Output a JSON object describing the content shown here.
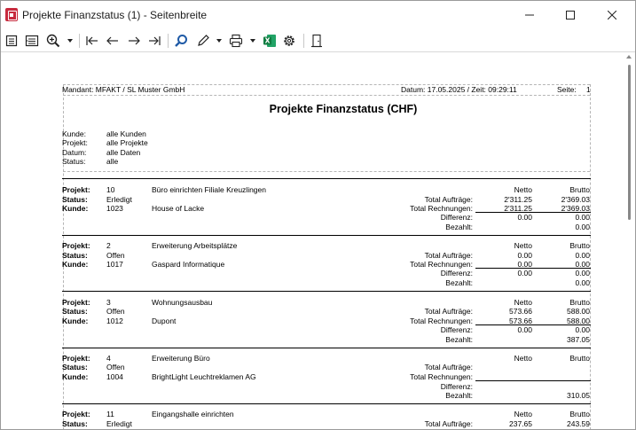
{
  "window": {
    "title": "Projekte Finanzstatus (1) - Seitenbreite",
    "controls": {
      "minimize": "minimize-icon",
      "maximize": "maximize-icon",
      "close": "close-icon"
    }
  },
  "toolbar": {
    "icons": [
      "single-page-icon",
      "page-width-icon",
      "zoom-icon",
      "first-page-icon",
      "previous-page-icon",
      "next-page-icon",
      "last-page-icon",
      "search-icon",
      "edit-icon",
      "print-icon",
      "excel-export-icon",
      "settings-icon",
      "exit-icon"
    ]
  },
  "report": {
    "mandant": "Mandant: MFAKT / SL Muster GmbH",
    "datum": "Datum: 17.05.2025 / Zeit: 09:29:11",
    "seite": "Seite:",
    "seite_nr": "1",
    "title": "Projekte Finanzstatus (CHF)",
    "filters": [
      {
        "label": "Kunde:",
        "value": "alle Kunden"
      },
      {
        "label": "Projekt:",
        "value": "alle Projekte"
      },
      {
        "label": "Datum:",
        "value": "alle Daten"
      },
      {
        "label": "Status:",
        "value": "alle"
      }
    ],
    "labels": {
      "projekt": "Projekt:",
      "status": "Status:",
      "kunde": "Kunde:",
      "netto": "Netto",
      "brutto": "Brutto",
      "total_auftraege": "Total Aufträge:",
      "total_rechnungen": "Total Rechnungen:",
      "differenz": "Differenz:",
      "bezahlt": "Bezahlt:"
    },
    "projects": [
      {
        "nr": "10",
        "name": "Büro einrichten Filiale Kreuzlingen",
        "status": "Erledigt",
        "kunde_nr": "1023",
        "kunde": "House of Lacke",
        "auftraege_netto": "2'311.25",
        "auftraege_brutto": "2'369.03",
        "rechnungen_netto": "2'311.25",
        "rechnungen_brutto": "2'369.03",
        "differenz_netto": "0.00",
        "differenz_brutto": "0.00",
        "bezahlt": "0.00"
      },
      {
        "nr": "2",
        "name": "Erweiterung Arbeitsplätze",
        "status": "Offen",
        "kunde_nr": "1017",
        "kunde": "Gaspard Informatique",
        "auftraege_netto": "0.00",
        "auftraege_brutto": "0.00",
        "rechnungen_netto": "0.00",
        "rechnungen_brutto": "0.00",
        "differenz_netto": "0.00",
        "differenz_brutto": "0.00",
        "bezahlt": "0.00"
      },
      {
        "nr": "3",
        "name": "Wohnungsausbau",
        "status": "Offen",
        "kunde_nr": "1012",
        "kunde": "Dupont",
        "auftraege_netto": "573.66",
        "auftraege_brutto": "588.00",
        "rechnungen_netto": "573.66",
        "rechnungen_brutto": "588.00",
        "differenz_netto": "0.00",
        "differenz_brutto": "0.00",
        "bezahlt": "387.05"
      },
      {
        "nr": "4",
        "name": "Erweiterung Büro",
        "status": "Offen",
        "kunde_nr": "1004",
        "kunde": "BrightLight Leuchtreklamen AG",
        "auftraege_netto": "",
        "auftraege_brutto": "",
        "rechnungen_netto": "",
        "rechnungen_brutto": "",
        "differenz_netto": "",
        "differenz_brutto": "",
        "bezahlt": "310.05"
      },
      {
        "nr": "11",
        "name": "Eingangshalle einrichten",
        "status": "Erledigt",
        "kunde_nr": "",
        "kunde": "",
        "auftraege_netto": "237.65",
        "auftraege_brutto": "243.59",
        "rechnungen_netto": "",
        "rechnungen_brutto": "",
        "differenz_netto": "",
        "differenz_brutto": "",
        "bezahlt": ""
      }
    ]
  }
}
